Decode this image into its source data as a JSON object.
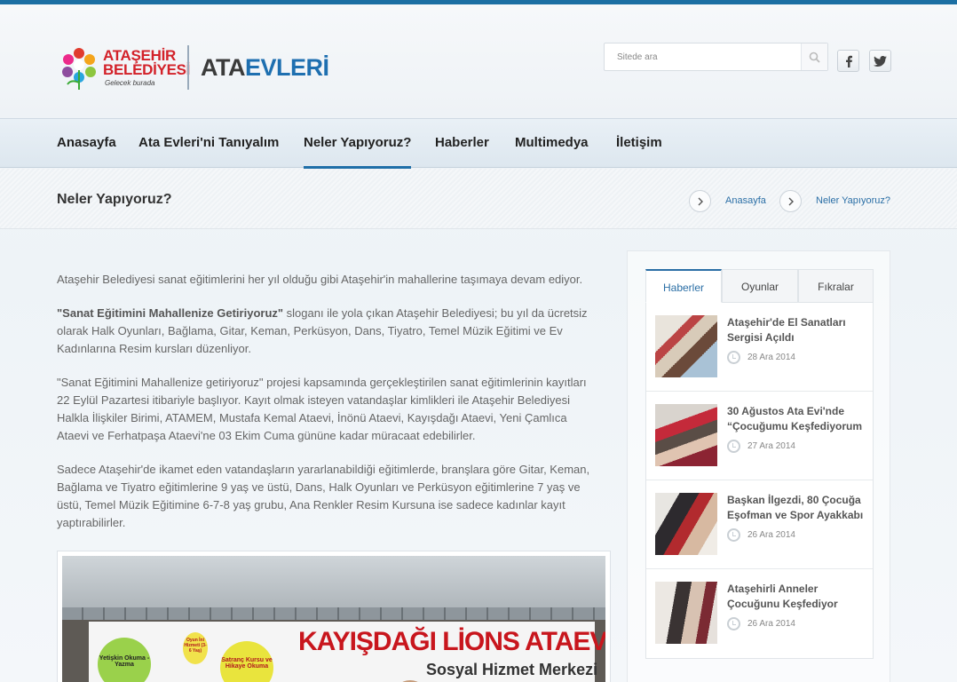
{
  "header": {
    "logo_line1": "ATAŞEHİR",
    "logo_line2": "BELEDİYESİ",
    "logo_tagline": "Gelecek burada",
    "brand_part1": "ATA",
    "brand_part2": "EVLERİ",
    "search_placeholder": "Sitede ara",
    "search_icon": "search-icon",
    "facebook_icon": "facebook-icon",
    "twitter_icon": "twitter-icon"
  },
  "nav": {
    "items": [
      {
        "label": "Anasayfa"
      },
      {
        "label": "Ata Evleri'ni Tanıyalım"
      },
      {
        "label": "Neler Yapıyoruz?"
      },
      {
        "label": "Haberler"
      },
      {
        "label": "Multimedya"
      },
      {
        "label": "İletişim"
      }
    ],
    "active": "Neler Yapıyoruz?"
  },
  "page": {
    "title": "Neler Yapıyoruz?",
    "breadcrumb": [
      "Anasayfa",
      "Neler Yapıyoruz?"
    ]
  },
  "content": {
    "p1": "Ataşehir Belediyesi sanat eğitimlerini her yıl olduğu gibi Ataşehir'in mahallerine taşımaya devam ediyor.",
    "p2_bold": "\"Sanat Eğitimini Mahallenize Getiriyoruz\"",
    "p2_rest": " sloganı ile yola çıkan Ataşehir Belediyesi; bu yıl da ücretsiz olarak Halk Oyunları, Bağlama, Gitar, Keman, Perküsyon, Dans, Tiyatro, Temel Müzik Eğitimi ve Ev Kadınlarına Resim kursları düzenliyor.",
    "p3": "\"Sanat Eğitimini Mahallenize getiriyoruz\" projesi kapsamında gerçekleştirilen sanat eğitimlerinin kayıtları 22 Eylül Pazartesi itibariyle başlıyor. Kayıt olmak isteyen vatandaşlar kimlikleri ile Ataşehir Belediyesi Halkla İlişkiler Birimi, ATAMEM, Mustafa Kemal Ataevi, İnönü Ataevi, Kayışdağı Ataevi, Yeni Çamlıca Ataevi ve Ferhatpaşa Ataevi'ne 03 Ekim Cuma gününe kadar müracaat edebilirler.",
    "p4": "Sadece Ataşehir'de ikamet eden vatandaşların yararlanabildiği eğitimlerde, branşlara göre Gitar, Keman, Bağlama ve Tiyatro eğitimlerine 9 yaş ve üstü, Dans, Halk Oyunları ve Perküsyon eğitimlerine 7 yaş ve üstü, Temel Müzik Eğitimine 6-7-8 yaş grubu, Ana Renkler Resim Kursuna ise sadece kadınlar kayıt yaptırabilirler.",
    "photo_sign1": "KAYIŞDAĞI LİONS ATAEVİ",
    "photo_sign2": "Sosyal Hizmet Merkezi",
    "photo_badge1": "Yetişkin Okuma - Yazma",
    "photo_badge2": "Satranç Kursu ve Hikaye Okuma",
    "photo_badge3": "Oyun İni Hizmeti (3-6 Yaş)"
  },
  "sidebar": {
    "tabs": [
      {
        "label": "Haberler"
      },
      {
        "label": "Oyunlar"
      },
      {
        "label": "Fıkralar"
      }
    ],
    "active_tab": "Haberler",
    "news": [
      {
        "title1": "Ataşehir'de El Sanatları",
        "title2": "Sergisi Açıldı",
        "date": "28 Ara 2014"
      },
      {
        "title1": "30 Ağustos Ata Evi'nde",
        "title2": "“Çocuğumu Keşfediyorum",
        "date": "27 Ara 2014"
      },
      {
        "title1": "Başkan İlgezdi, 80 Çocuğa",
        "title2": "Eşofman ve Spor Ayakkabı",
        "date": "26 Ara 2014"
      },
      {
        "title1": "Ataşehirli Anneler",
        "title2": "Çocuğunu Keşfediyor",
        "date": "26 Ara 2014"
      }
    ]
  },
  "colors": {
    "accent": "#1f6fa8",
    "logo_red": "#d3222a",
    "link": "#2b6fa6"
  }
}
